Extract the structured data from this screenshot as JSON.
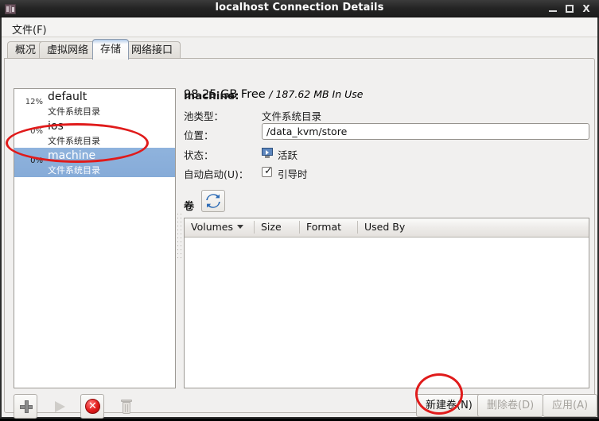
{
  "window": {
    "title": "localhost Connection Details",
    "icon": "app-icon",
    "controls": {
      "minimize": "minimize-icon",
      "maximize": "maximize-icon",
      "close": "X"
    }
  },
  "menubar": {
    "file": "文件(F)"
  },
  "tabs": [
    {
      "label": "概况",
      "selected": false
    },
    {
      "label": "虚拟网络",
      "selected": false
    },
    {
      "label": "存储",
      "selected": true
    },
    {
      "label": "网络接口",
      "selected": false
    }
  ],
  "pool_list": [
    {
      "percent": "12%",
      "name": "default",
      "type": "文件系统目录",
      "selected": false
    },
    {
      "percent": "0%",
      "name": "ios",
      "type": "文件系统目录",
      "selected": false
    },
    {
      "percent": "0%",
      "name": "machine",
      "type": "文件系统目录",
      "selected": true
    }
  ],
  "details": {
    "name_label": "machine:",
    "free_value": "98.25 GB Free",
    "used_value": "/ 187.62 MB In Use",
    "pool_type_label": "池类型：",
    "pool_type_value": "文件系统目录",
    "location_label": "位置：",
    "location_value": "/data_kvm/store",
    "state_label": "状态：",
    "state_value": "活跃",
    "state_icon": "active-monitor-icon",
    "autostart_label": "自动启动(U)：",
    "autostart_value": "引导时",
    "autostart_checked": true
  },
  "volumes": {
    "section_label": "卷",
    "refresh_icon": "refresh-icon",
    "columns": [
      "Volumes",
      "Size",
      "Format",
      "Used By"
    ],
    "rows": []
  },
  "toolbar": [
    {
      "name": "add-pool-button",
      "icon": "plus-icon",
      "enabled": true
    },
    {
      "name": "start-pool-button",
      "icon": "play-icon",
      "enabled": false
    },
    {
      "name": "stop-pool-button",
      "icon": "stop-icon",
      "enabled": true
    },
    {
      "name": "delete-pool-button",
      "icon": "trash-icon",
      "enabled": false
    }
  ],
  "buttons": {
    "new_volume": "新建卷(N)",
    "delete_volume": "删除卷(D)",
    "apply": "应用(A)"
  },
  "annotations": {
    "accent_color": "#e01b1b",
    "highlights": [
      "machine-pool-row",
      "new-volume-button"
    ]
  }
}
